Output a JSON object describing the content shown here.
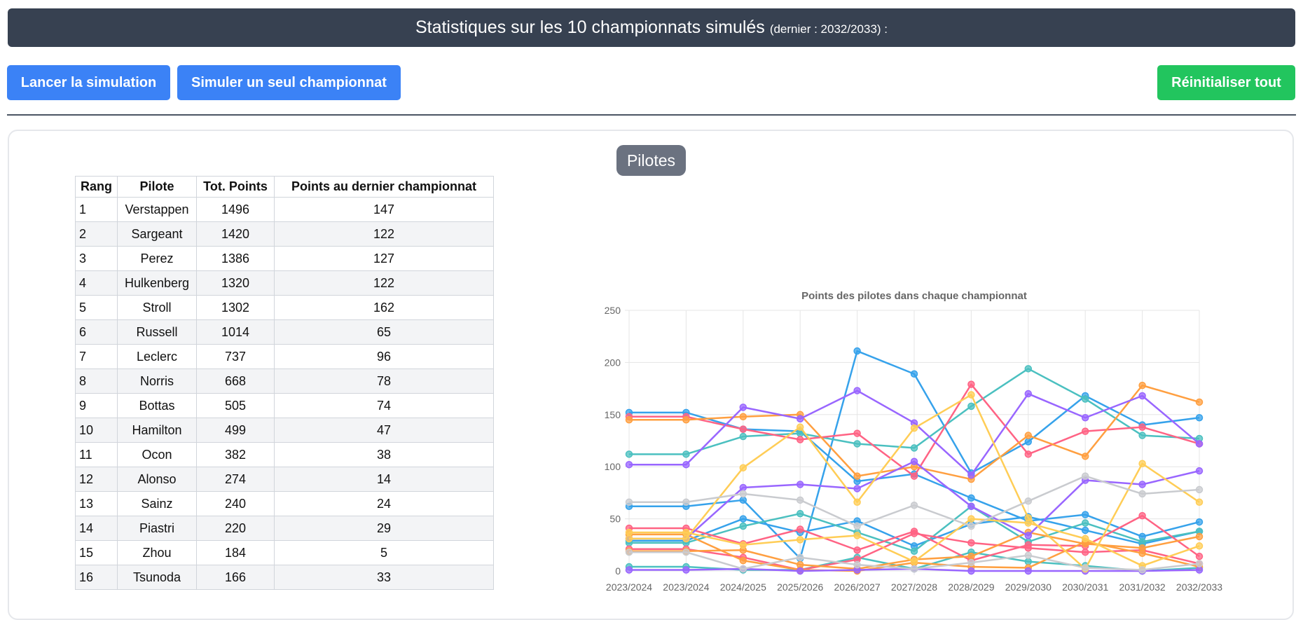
{
  "header": {
    "title": "Statistiques sur les 10 championnats simulés",
    "subtitle": "(dernier : 2032/2033) :"
  },
  "toolbar": {
    "launch_label": "Lancer la simulation",
    "single_label": "Simuler un seul championnat",
    "reset_label": "Réinitialiser tout"
  },
  "section": {
    "label": "Pilotes"
  },
  "table": {
    "headers": [
      "Rang",
      "Pilote",
      "Tot. Points",
      "Points au dernier championnat"
    ],
    "rows": [
      {
        "rank": "1",
        "driver": "Verstappen",
        "total": "1496",
        "last": "147"
      },
      {
        "rank": "2",
        "driver": "Sargeant",
        "total": "1420",
        "last": "122"
      },
      {
        "rank": "3",
        "driver": "Perez",
        "total": "1386",
        "last": "127"
      },
      {
        "rank": "4",
        "driver": "Hulkenberg",
        "total": "1320",
        "last": "122"
      },
      {
        "rank": "5",
        "driver": "Stroll",
        "total": "1302",
        "last": "162"
      },
      {
        "rank": "6",
        "driver": "Russell",
        "total": "1014",
        "last": "65"
      },
      {
        "rank": "7",
        "driver": "Leclerc",
        "total": "737",
        "last": "96"
      },
      {
        "rank": "8",
        "driver": "Norris",
        "total": "668",
        "last": "78"
      },
      {
        "rank": "9",
        "driver": "Bottas",
        "total": "505",
        "last": "74"
      },
      {
        "rank": "10",
        "driver": "Hamilton",
        "total": "499",
        "last": "47"
      },
      {
        "rank": "11",
        "driver": "Ocon",
        "total": "382",
        "last": "38"
      },
      {
        "rank": "12",
        "driver": "Alonso",
        "total": "274",
        "last": "14"
      },
      {
        "rank": "13",
        "driver": "Sainz",
        "total": "240",
        "last": "24"
      },
      {
        "rank": "14",
        "driver": "Piastri",
        "total": "220",
        "last": "29"
      },
      {
        "rank": "15",
        "driver": "Zhou",
        "total": "184",
        "last": "5"
      },
      {
        "rank": "16",
        "driver": "Tsunoda",
        "total": "166",
        "last": "33"
      }
    ]
  },
  "chart_data": {
    "type": "line",
    "title": "Points des pilotes dans chaque championnat",
    "xlabel": "",
    "ylabel": "",
    "ylim": [
      0,
      250
    ],
    "yticks": [
      0,
      50,
      100,
      150,
      200,
      250
    ],
    "grid": true,
    "categories": [
      "2023/2024",
      "2023/2024",
      "2024/2025",
      "2025/2026",
      "2026/2027",
      "2027/2028",
      "2028/2029",
      "2029/2030",
      "2030/2031",
      "2031/2032",
      "2032/2033"
    ],
    "series": [
      {
        "color": "#36a2eb",
        "values": [
          152,
          152,
          136,
          134,
          86,
          93,
          70,
          48,
          54,
          33,
          47
        ]
      },
      {
        "color": "#36a2eb",
        "values": [
          62,
          62,
          68,
          12,
          211,
          189,
          94,
          124,
          168,
          140,
          147
        ]
      },
      {
        "color": "#36a2eb",
        "values": [
          29,
          29,
          50,
          37,
          48,
          24,
          45,
          52,
          39,
          26,
          38
        ]
      },
      {
        "color": "#4bc0c0",
        "values": [
          112,
          112,
          129,
          132,
          122,
          118,
          158,
          194,
          165,
          130,
          127
        ]
      },
      {
        "color": "#4bc0c0",
        "values": [
          27,
          27,
          43,
          55,
          37,
          19,
          62,
          28,
          46,
          28,
          38
        ]
      },
      {
        "color": "#4bc0c0",
        "values": [
          4,
          4,
          1,
          1,
          13,
          2,
          18,
          9,
          5,
          0,
          3
        ]
      },
      {
        "color": "#ff6384",
        "values": [
          148,
          148,
          136,
          126,
          132,
          91,
          179,
          112,
          134,
          138,
          122
        ]
      },
      {
        "color": "#ff6384",
        "values": [
          41,
          41,
          26,
          40,
          20,
          38,
          10,
          25,
          24,
          53,
          14
        ]
      },
      {
        "color": "#ff6384",
        "values": [
          21,
          21,
          13,
          1,
          11,
          36,
          27,
          22,
          18,
          20,
          7
        ]
      },
      {
        "color": "#ff9f40",
        "values": [
          145,
          145,
          148,
          150,
          91,
          100,
          88,
          130,
          110,
          178,
          162
        ]
      },
      {
        "color": "#ff9f40",
        "values": [
          19,
          19,
          20,
          6,
          2,
          11,
          14,
          37,
          26,
          22,
          33
        ]
      },
      {
        "color": "#ff9f40",
        "values": [
          35,
          35,
          10,
          1,
          0,
          8,
          4,
          3,
          28,
          17,
          4
        ]
      },
      {
        "color": "#9966ff",
        "values": [
          102,
          102,
          157,
          146,
          173,
          142,
          92,
          170,
          147,
          168,
          122
        ]
      },
      {
        "color": "#9966ff",
        "values": [
          31,
          31,
          80,
          83,
          79,
          105,
          62,
          34,
          87,
          83,
          96
        ]
      },
      {
        "color": "#9966ff",
        "values": [
          1,
          1,
          2,
          0,
          1,
          2,
          0,
          0,
          0,
          0,
          1
        ]
      },
      {
        "color": "#ffcd56",
        "values": [
          31,
          31,
          99,
          138,
          66,
          137,
          169,
          51,
          2,
          103,
          66
        ]
      },
      {
        "color": "#ffcd56",
        "values": [
          37,
          37,
          25,
          30,
          34,
          9,
          50,
          46,
          31,
          5,
          24
        ]
      },
      {
        "color": "#c9cbcf",
        "values": [
          66,
          66,
          74,
          68,
          43,
          63,
          43,
          67,
          91,
          74,
          78
        ]
      },
      {
        "color": "#c9cbcf",
        "values": [
          18,
          18,
          2,
          13,
          6,
          2,
          8,
          15,
          3,
          1,
          7
        ]
      }
    ]
  }
}
